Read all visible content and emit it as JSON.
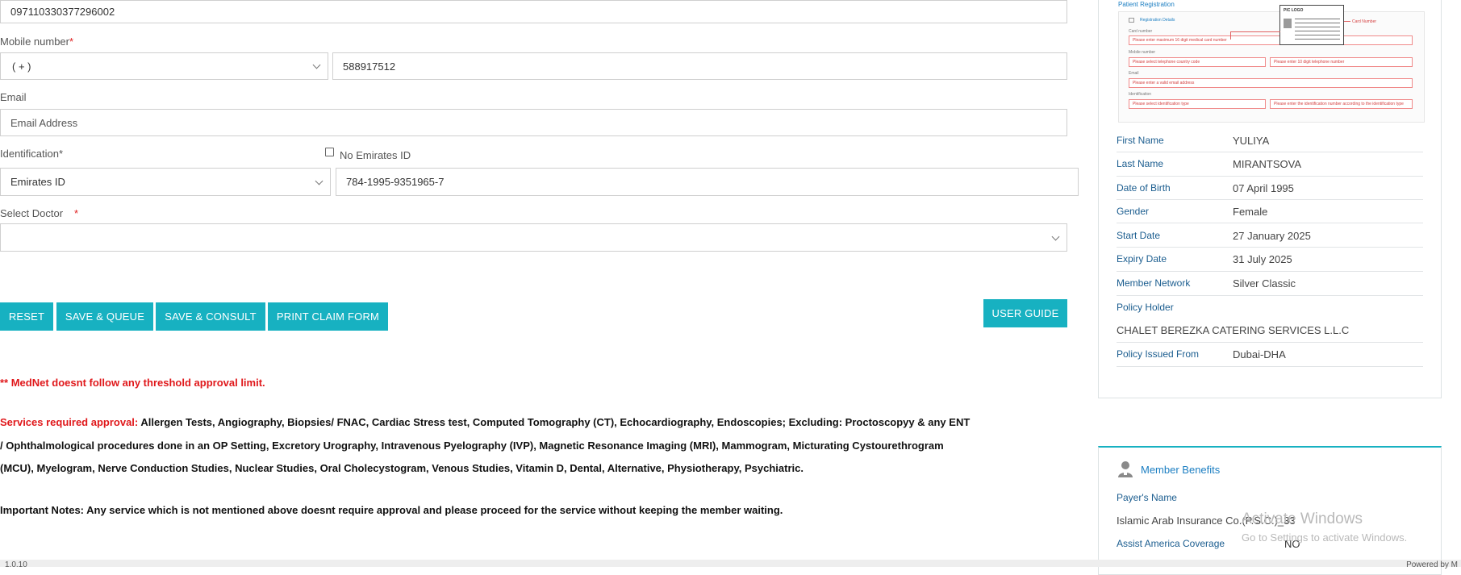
{
  "form": {
    "card_number_value": "097110330377296002",
    "mobile_label": "Mobile number",
    "required_mark": "*",
    "country_code_value": "( + )",
    "mobile_value": "588917512",
    "email_label": "Email",
    "email_placeholder": "Email Address",
    "identification_label": "Identification*",
    "no_emirates_id_label": "No Emirates ID",
    "id_type_value": "Emirates ID",
    "id_number_value": "784-1995-9351965-7",
    "doctor_label": "Select Doctor",
    "doctor_value": ""
  },
  "buttons": {
    "reset": "RESET",
    "save_queue": "SAVE & QUEUE",
    "save_consult": "SAVE & CONSULT",
    "print_claim": "PRINT CLAIM FORM",
    "user_guide": "USER GUIDE"
  },
  "notes": {
    "threshold": "** MedNet doesnt follow any threshold approval limit.",
    "services_label": "Services required approval:",
    "services_line1": " Allergen Tests, Angiography, Biopsies/ FNAC, Cardiac Stress test, Computed Tomography (CT), Echocardiography, Endoscopies; Excluding: Proctoscopyy & any ENT",
    "services_line2": "/ Ophthalmological procedures done in an OP Setting, Excretory Urography, Intravenous Pyelography (IVP), Magnetic Resonance Imaging (MRI), Mammogram, Micturating Cystourethrogram",
    "services_line3": "(MCU), Myelogram, Nerve Conduction Studies, Nuclear Studies, Oral Cholecystogram, Venous Studies, Vitamin D, Dental, Alternative, Physiotherapy, Psychiatric.",
    "important": "Important Notes: Any service which is not mentioned above doesnt require approval and please proceed for the service without keeping the member waiting."
  },
  "thumbnail": {
    "title": "Patient Registration",
    "section": "Registration Details",
    "card_label": "Card number",
    "card_error": "Please enter maximum 16 digit medical card number",
    "mobile_label": "Mobile number",
    "country_error": "Please select telephone country code",
    "mobile_error": "Please enter 10 digit telephone number",
    "email_label": "Email",
    "email_error": "Please enter a valid email address",
    "id_label": "Identification",
    "id_type_error": "Please select identification type",
    "id_number_error": "Please enter the identification number according to the identification type",
    "card_logo": "PIC LOGO",
    "card_number_note": "Card Number"
  },
  "member": {
    "rows": [
      {
        "label": "First Name",
        "value": "YULIYA"
      },
      {
        "label": "Last Name",
        "value": "MIRANTSOVA"
      },
      {
        "label": "Date of Birth",
        "value": "07 April 1995"
      },
      {
        "label": "Gender",
        "value": "Female"
      },
      {
        "label": "Start Date",
        "value": "27 January 2025"
      },
      {
        "label": "Expiry Date",
        "value": "31 July 2025"
      },
      {
        "label": "Member Network",
        "value": "Silver Classic"
      }
    ],
    "policy_holder_label": "Policy Holder",
    "policy_holder_value": "CHALET BEREZKA CATERING SERVICES L.L.C",
    "issued_from_label": "Policy Issued From",
    "issued_from_value": "Dubai-DHA"
  },
  "benefits": {
    "title": "Member Benefits",
    "payer_label": "Payer's Name",
    "payer_value": "Islamic Arab Insurance Co.(P.S.C.)_33",
    "assist_label": "Assist America Coverage",
    "assist_value": "NO"
  },
  "watermark": {
    "line1": "Activate Windows",
    "line2": "Go to Settings to activate Windows."
  },
  "footer": {
    "version": "1.0.10",
    "powered": "Powered by M"
  },
  "colors": {
    "accent": "#17b1c1",
    "label_blue": "#1b5d8f",
    "required_red": "#e02020"
  }
}
